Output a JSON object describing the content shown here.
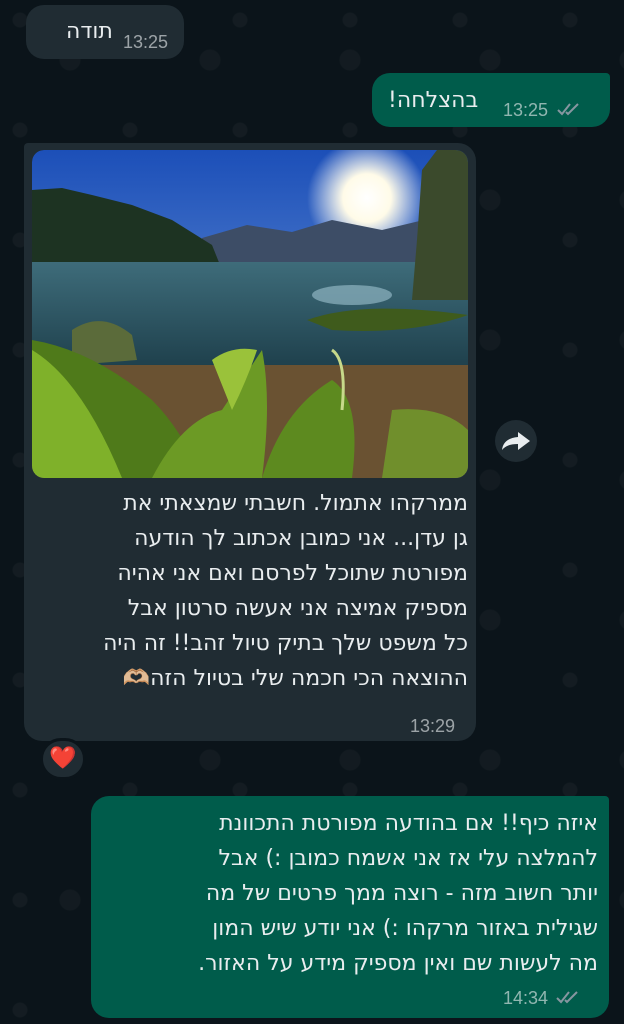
{
  "messages": [
    {
      "id": "m1",
      "direction": "in",
      "text": "תודה",
      "time": "13:25"
    },
    {
      "id": "m2",
      "direction": "out",
      "text": "בהצלחה!",
      "time": "13:25",
      "status": "read"
    },
    {
      "id": "m3",
      "direction": "in",
      "type": "image",
      "image_description": "lake-landscape",
      "caption_lines": [
        "ממרקהו אתמול. חשבתי שמצאתי את",
        "גן עדן... אני כמובן אכתוב לך הודעה",
        "מפורטת שתוכל לפרסם ואם אני אהיה",
        "מספיק אמיצה אני אעשה סרטון אבל",
        "כל משפט שלך בתיק טיול זהב!! זה היה",
        "ההוצאה הכי חכמה שלי בטיול הזה🫶🏼"
      ],
      "time": "13:29",
      "reaction": "❤️"
    },
    {
      "id": "m4",
      "direction": "out",
      "lines": [
        "איזה כיף!! אם בהודעה מפורטת התכוונת",
        "להמלצה עלי אז אני אשמח כמובן :) אבל",
        "יותר חשוב מזה - רוצה ממך פרטים של מה",
        "שגילית באזור מרקהו :) אני יודע שיש המון",
        "מה לעשות שם ואין מספיק מידע על האזור."
      ],
      "time": "14:34",
      "status": "read"
    }
  ],
  "colors": {
    "background": "#0b141a",
    "incoming_bubble": "#202c33",
    "outgoing_bubble": "#005c4b",
    "read_ticks": "#8696a0"
  },
  "icons": {
    "forward": "forward-icon",
    "ticks": "double-check-icon",
    "reaction": "heart-icon"
  }
}
